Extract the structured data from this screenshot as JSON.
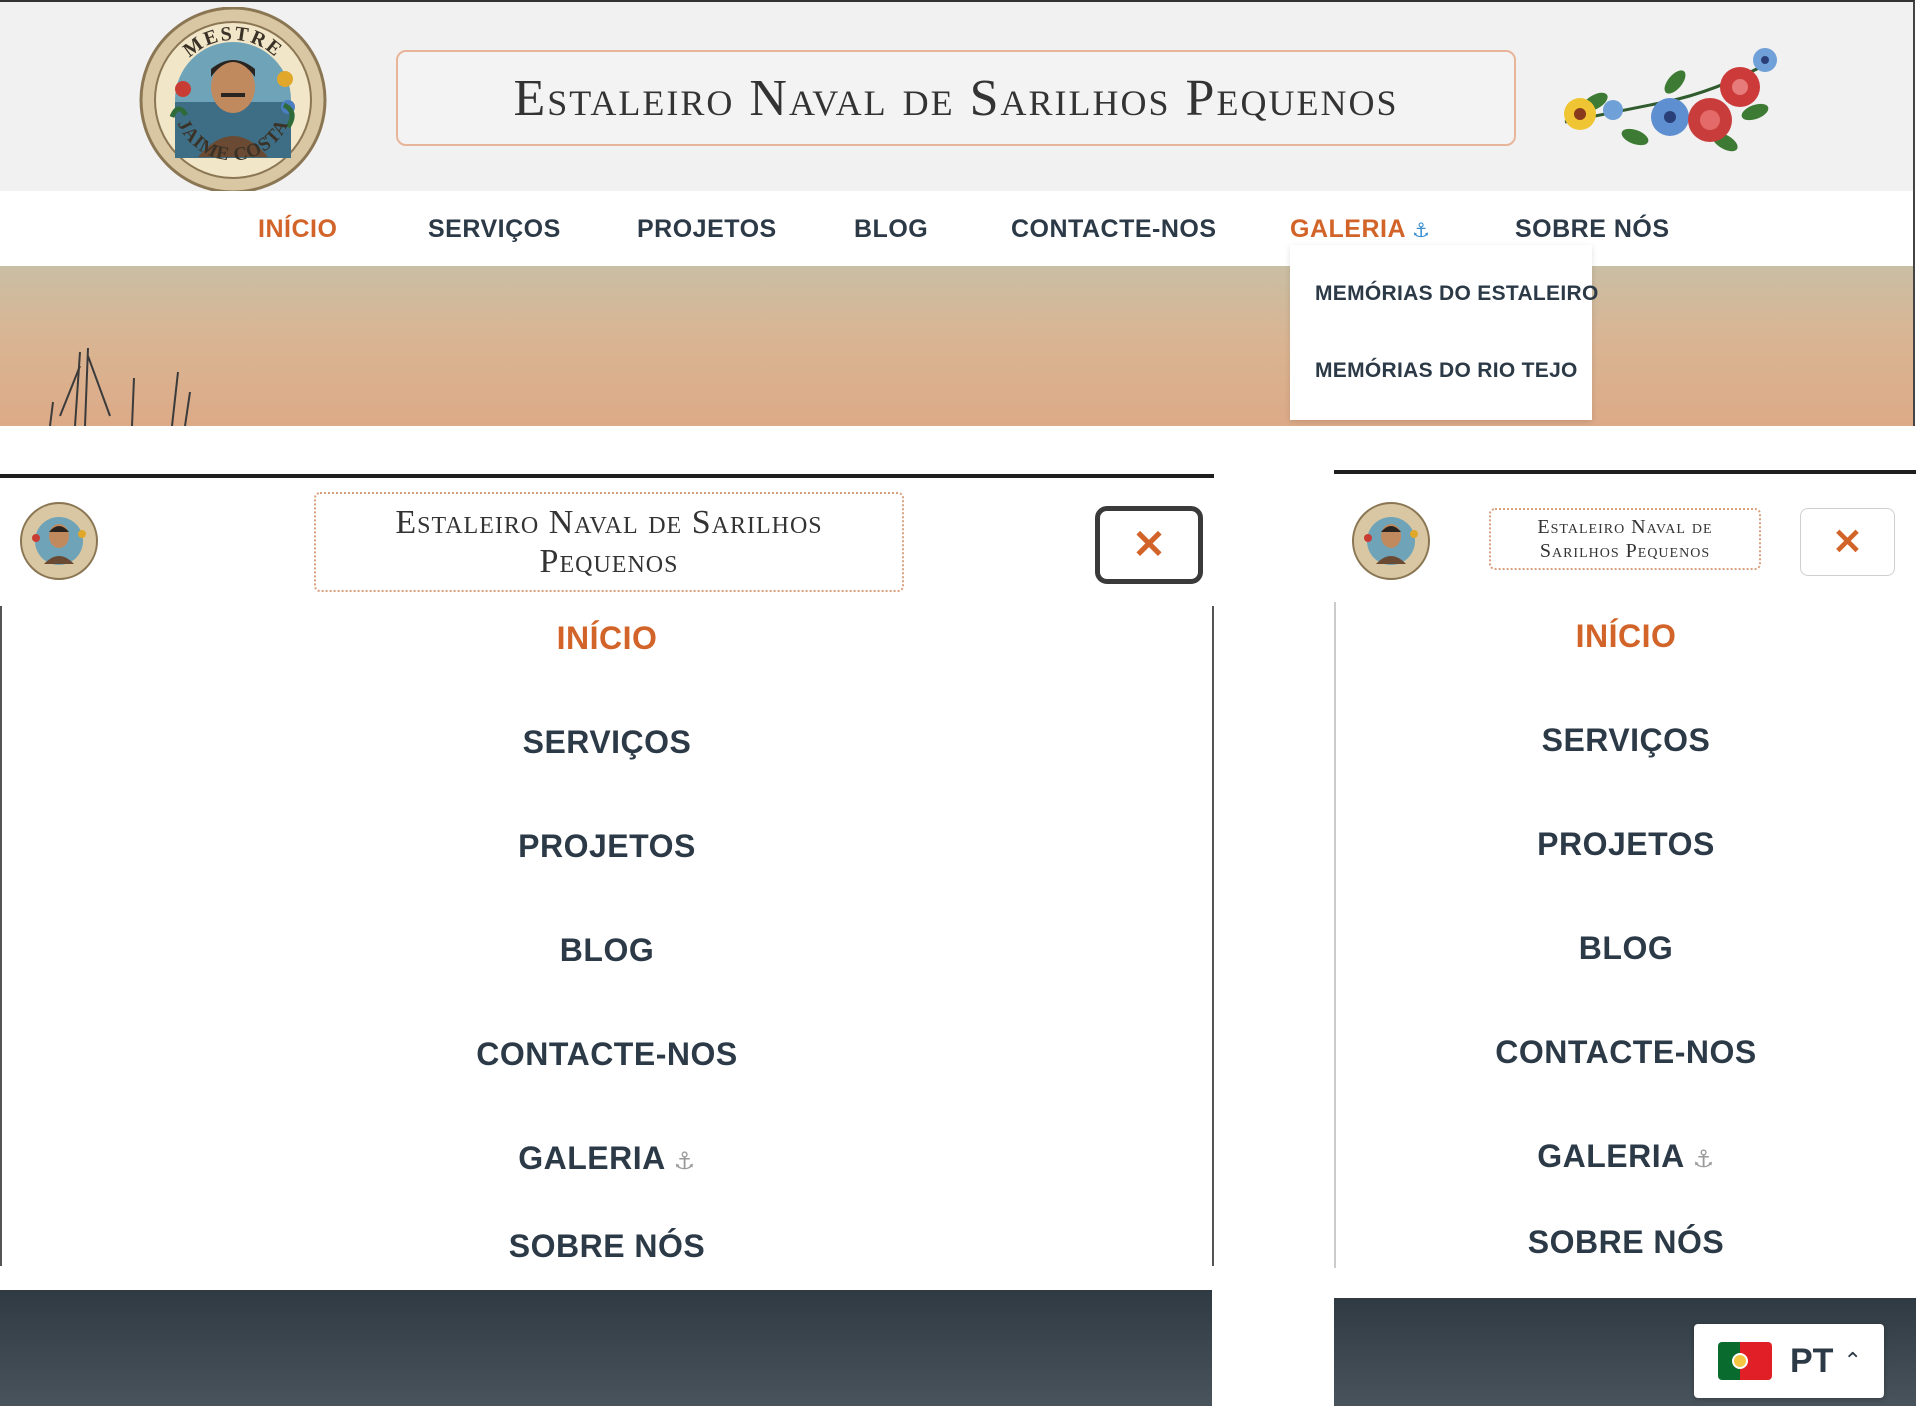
{
  "site": {
    "title": "Estaleiro Naval de Sarilhos Pequenos",
    "title_mobile_line1": "Estaleiro Naval de Sarilhos",
    "title_mobile_line2": "Pequenos",
    "title_small_line1": "Estaleiro Naval de",
    "title_small_line2": "Sarilhos Pequenos",
    "logo_top_text": "MESTRE",
    "logo_bottom_text": "JAIME COSTA"
  },
  "nav": {
    "items": [
      {
        "label": "INÍCIO",
        "active": true
      },
      {
        "label": "SERVIÇOS"
      },
      {
        "label": "PROJETOS"
      },
      {
        "label": "BLOG"
      },
      {
        "label": "CONTACTE-NOS"
      },
      {
        "label": "GALERIA",
        "has_submenu": true
      },
      {
        "label": "SOBRE NÓS"
      }
    ],
    "submenu_icon": "⚓",
    "galeria_submenu": [
      {
        "label": "MEMÓRIAS DO ESTALEIRO"
      },
      {
        "label": "MEMÓRIAS DO RIO TEJO"
      }
    ]
  },
  "mobile": {
    "close_icon": "close-icon",
    "close_glyph": "✕"
  },
  "language": {
    "code": "PT",
    "flag": "portugal-flag-icon",
    "chevron": "⌃"
  },
  "colors": {
    "accent": "#d2642a",
    "text": "#2c3a47",
    "title_border": "#e8b59a"
  }
}
